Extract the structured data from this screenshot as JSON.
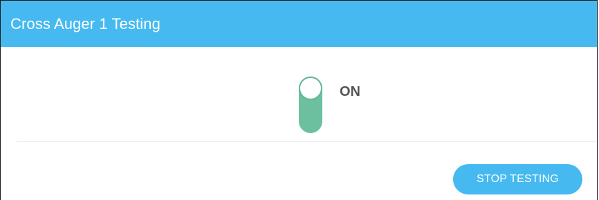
{
  "dialog": {
    "title": "Cross Auger 1 Testing",
    "toggle": {
      "state_label": "ON",
      "is_on": true
    },
    "stop_button_label": "STOP TESTING"
  },
  "colors": {
    "header_bg": "#46baf0",
    "toggle_on": "#6cc0a0",
    "button_bg": "#46baf0"
  }
}
